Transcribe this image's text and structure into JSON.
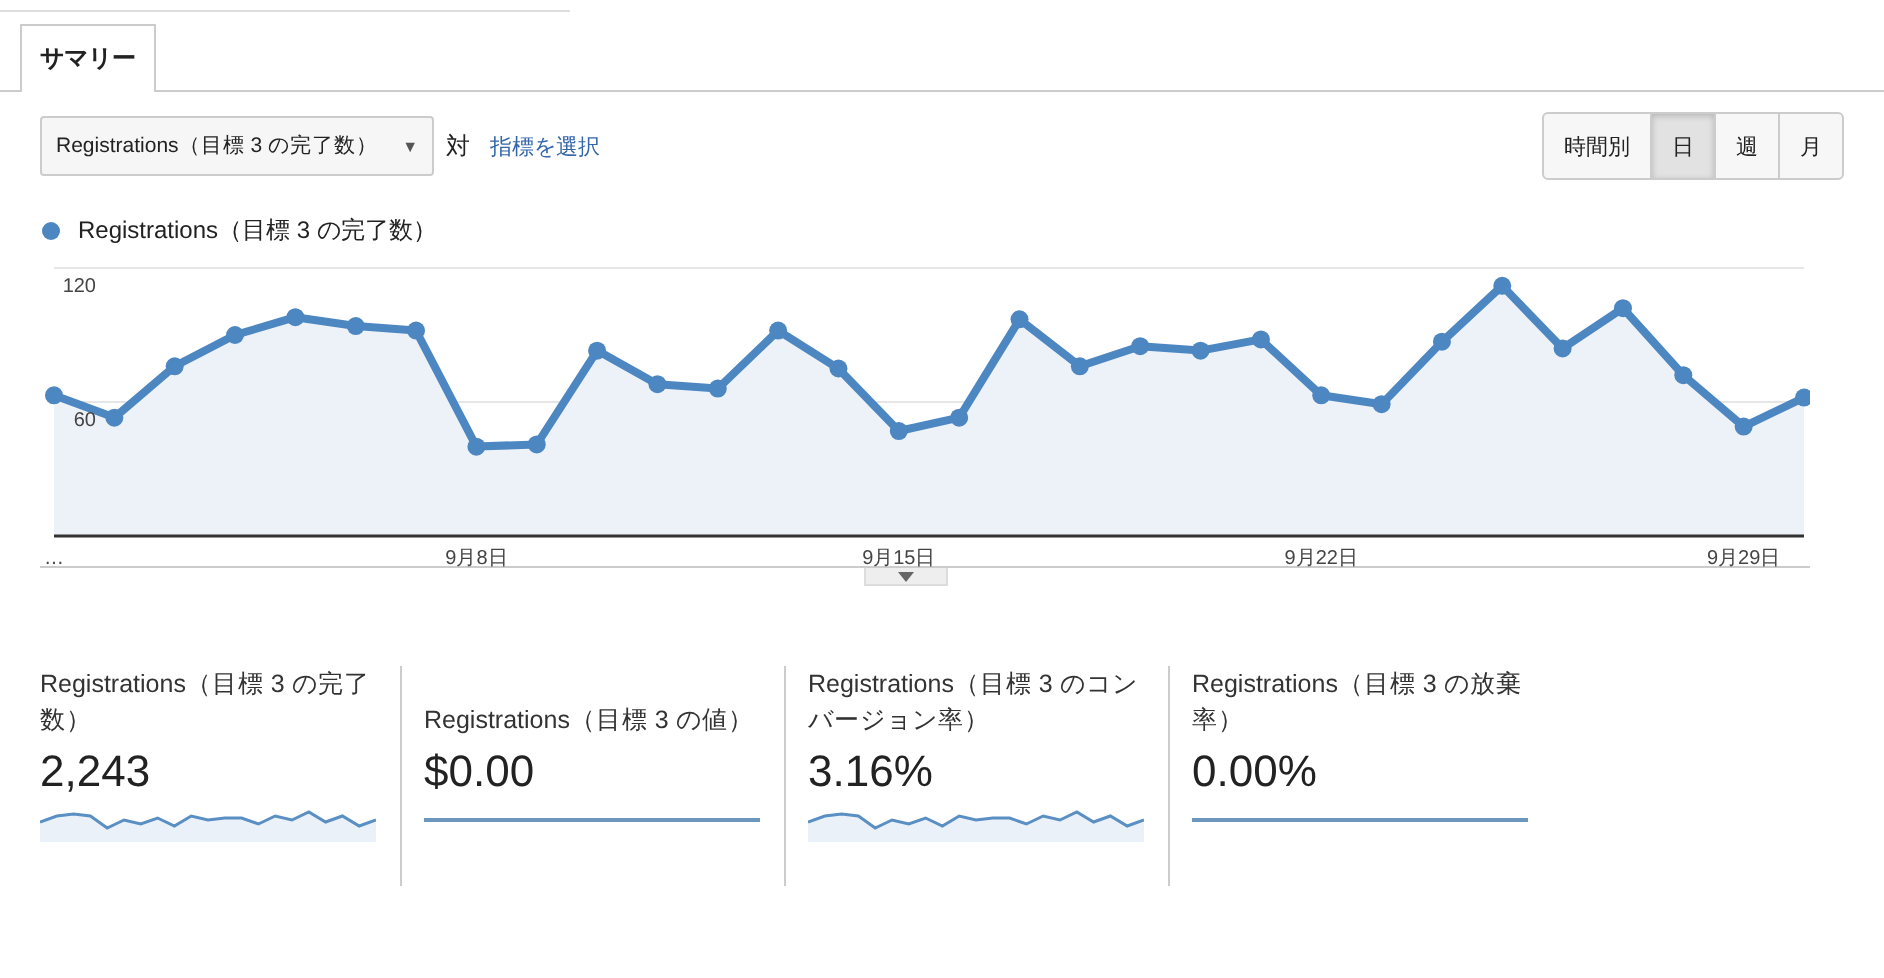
{
  "tabs": [
    {
      "label": "サマリー",
      "selected": true
    }
  ],
  "metric_selector": {
    "value": "Registrations（目標 3 の完了数）",
    "caret": "▼"
  },
  "versus_label": "対",
  "select_metric_link": "指標を選択",
  "granularity_buttons": [
    {
      "label": "時間別",
      "selected": false
    },
    {
      "label": "日",
      "selected": true
    },
    {
      "label": "週",
      "selected": false
    },
    {
      "label": "月",
      "selected": false
    }
  ],
  "chart": {
    "chart_data": {
      "type": "area",
      "categories": [
        "…",
        null,
        null,
        null,
        null,
        null,
        null,
        "9月8日",
        null,
        null,
        null,
        null,
        null,
        null,
        "9月15日",
        null,
        null,
        null,
        null,
        null,
        null,
        "9月22日",
        null,
        null,
        null,
        null,
        null,
        null,
        "9月29日",
        null
      ],
      "series": [
        {
          "name": "Registrations（目標 3 の完了数）",
          "color": "#4d87c2",
          "values": [
            63,
            53,
            76,
            90,
            98,
            94,
            92,
            40,
            41,
            83,
            68,
            66,
            92,
            75,
            47,
            53,
            97,
            76,
            85,
            83,
            88,
            63,
            59,
            87,
            112,
            84,
            102,
            72,
            49,
            62
          ]
        }
      ],
      "ylim": [
        0,
        120
      ],
      "yticks": [
        {
          "value": 60,
          "label": "60"
        },
        {
          "value": 120,
          "label": "120"
        }
      ]
    }
  },
  "scorecards": [
    {
      "label": "Registrations（目標 3 の完了数）",
      "value": "2,243",
      "kind": "varying"
    },
    {
      "label": "Registrations（目標 3 の値）",
      "value": "$0.00",
      "kind": "flat"
    },
    {
      "label": "Registrations（目標 3 のコンバージョン率）",
      "value": "3.16%",
      "kind": "varying"
    },
    {
      "label": "Registrations（目標 3 の放棄率）",
      "value": "0.00%",
      "kind": "flat"
    }
  ]
}
